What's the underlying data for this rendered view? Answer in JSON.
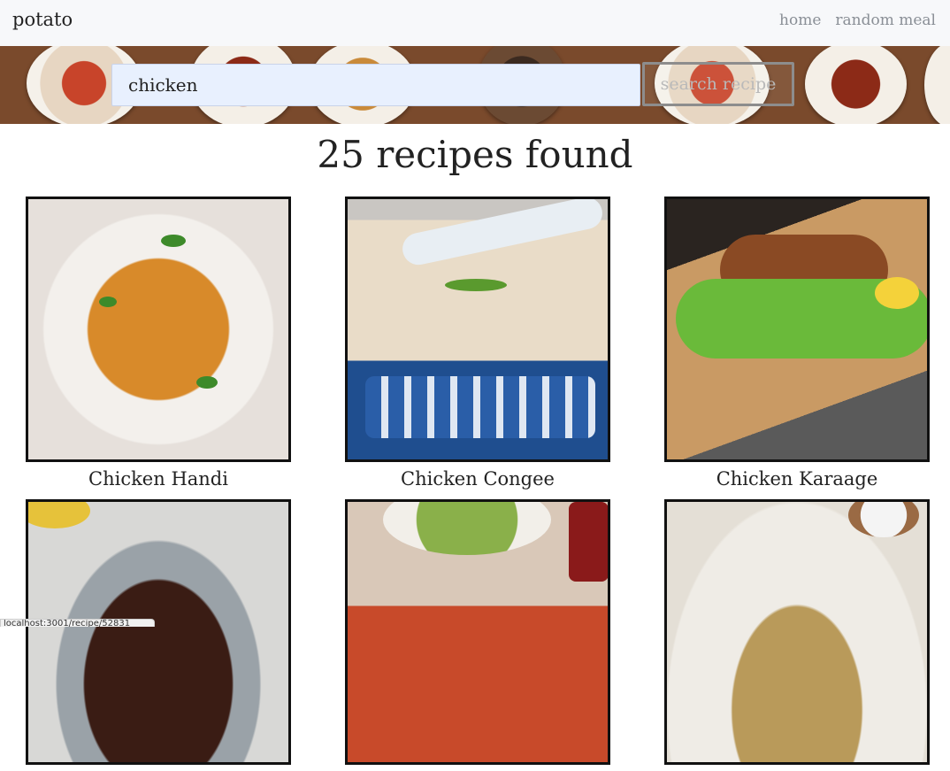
{
  "navbar": {
    "brand": "potato",
    "links": [
      {
        "label": "home"
      },
      {
        "label": "random meal"
      }
    ]
  },
  "search": {
    "value": "chicken",
    "placeholder": "",
    "button_label": "search recipe"
  },
  "results": {
    "title": "25 recipes found",
    "cards": [
      {
        "title": "Chicken Handi"
      },
      {
        "title": "Chicken Congee"
      },
      {
        "title": "Chicken Karaage"
      },
      {
        "title": ""
      },
      {
        "title": ""
      },
      {
        "title": ""
      }
    ]
  },
  "status_bar": {
    "url": "localhost:3001/recipe/52831"
  },
  "colors": {
    "navbar_bg": "#f7f8fa",
    "input_bg": "#e8f0fe",
    "card_border": "#111111"
  }
}
